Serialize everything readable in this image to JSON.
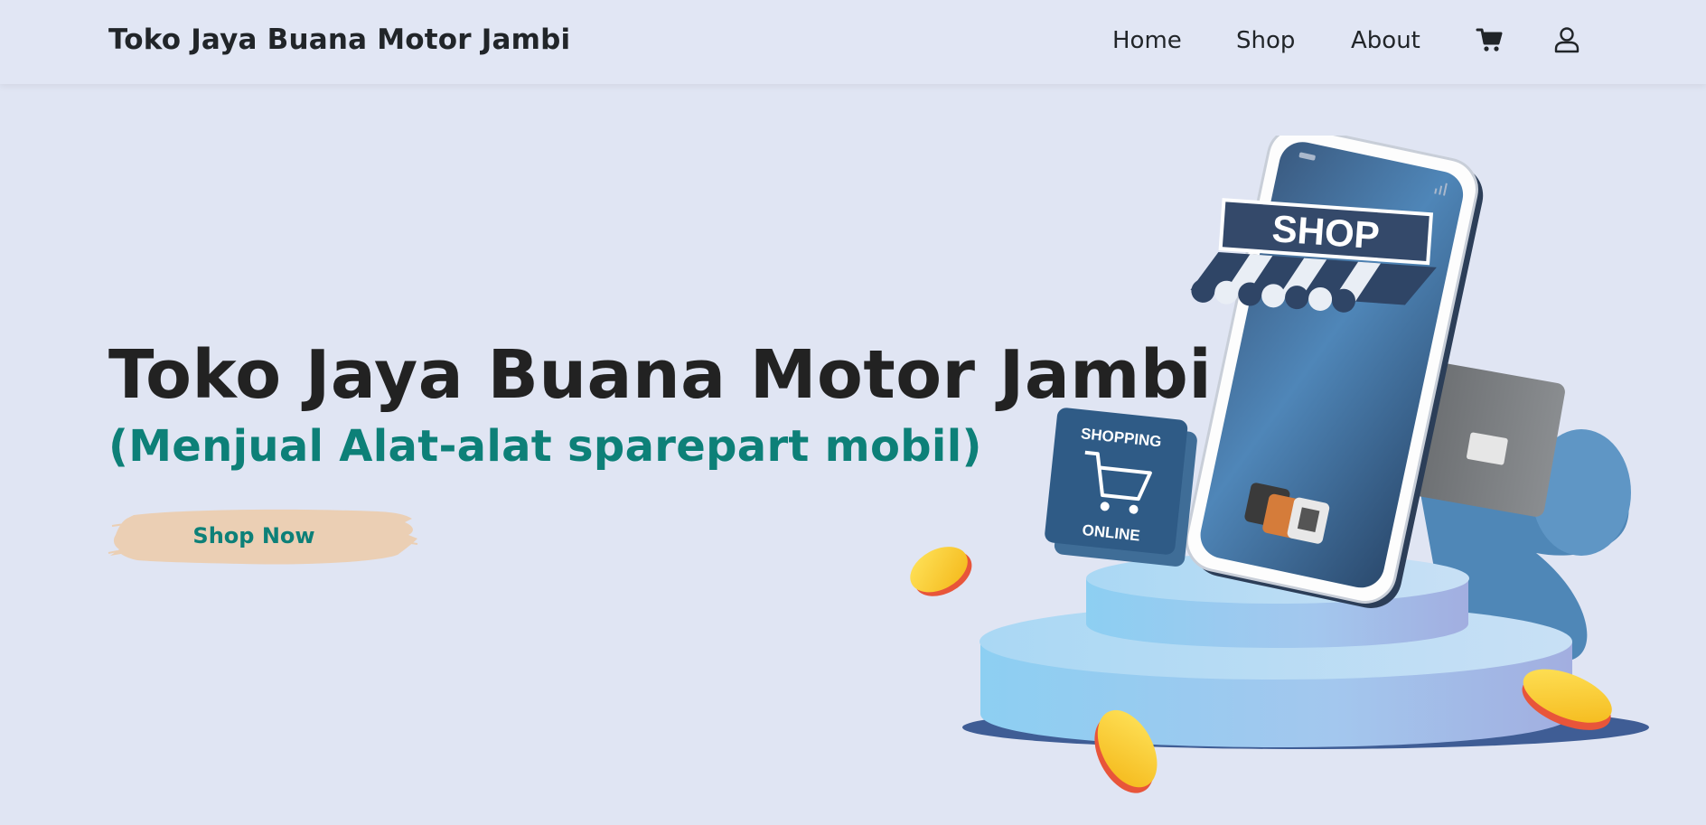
{
  "navbar": {
    "brand": "Toko Jaya Buana Motor Jambi",
    "links": [
      {
        "label": "Home"
      },
      {
        "label": "Shop"
      },
      {
        "label": "About"
      }
    ],
    "icons": [
      "cart-icon",
      "user-icon"
    ]
  },
  "hero": {
    "title": "Toko Jaya Buana Motor Jambi",
    "subtitle": "(Menjual Alat-alat sparepart mobil)",
    "cta_label": "Shop Now",
    "illustration": {
      "awning_text": "SHOP",
      "badge_top": "SHOPPING",
      "badge_bottom": "ONLINE"
    }
  },
  "colors": {
    "background": "#e0e5f3",
    "accent": "#0d8078",
    "button_brush": "#ebcfb4",
    "text": "#212529"
  }
}
